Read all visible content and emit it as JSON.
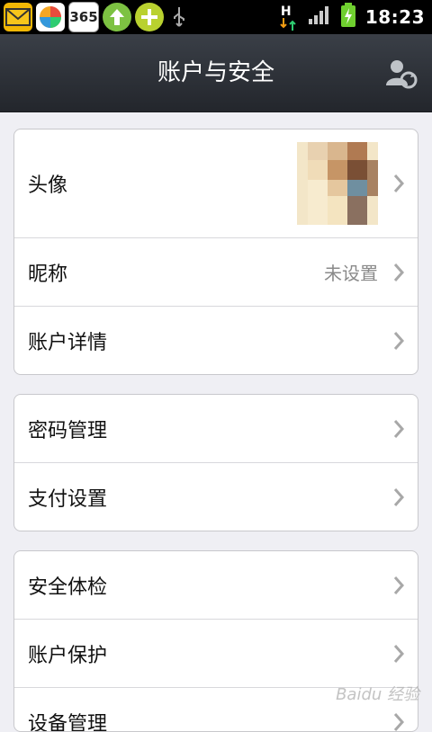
{
  "status_bar": {
    "time": "18:23",
    "app_icon_365": "365",
    "icons": [
      "mail-icon",
      "colorful-app-icon",
      "calendar-365-icon",
      "upload-arrow-icon",
      "plus-mail-icon",
      "usb-icon",
      "network-h-icon",
      "signal-icon",
      "battery-charging-icon"
    ],
    "network_letter": "H"
  },
  "header": {
    "title": "账户与安全",
    "right_icon": "user-sync-icon"
  },
  "groups": [
    {
      "items": [
        {
          "label": "头像",
          "type": "avatar"
        },
        {
          "label": "昵称",
          "value": "未设置"
        },
        {
          "label": "账户详情"
        }
      ]
    },
    {
      "items": [
        {
          "label": "密码管理"
        },
        {
          "label": "支付设置"
        }
      ]
    },
    {
      "items": [
        {
          "label": "安全体检"
        },
        {
          "label": "账户保护"
        },
        {
          "label": "设备管理"
        }
      ]
    }
  ],
  "watermark": "Baidu 经验",
  "colors": {
    "header_top": "#3a3f47",
    "header_bottom": "#23262c",
    "background": "#efeff4",
    "value_text": "#8a8a8a"
  }
}
